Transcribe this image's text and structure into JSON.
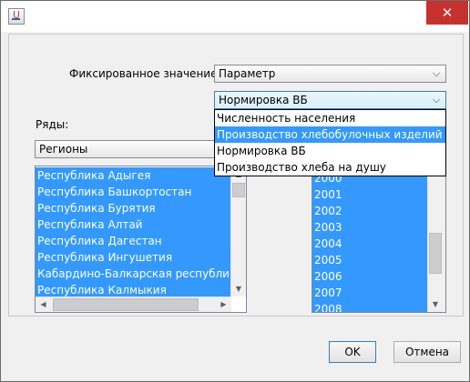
{
  "window": {
    "close_glyph": "✕"
  },
  "form": {
    "fixed_value_label": "Фиксированное значение:",
    "fixed_value_combo": "Параметр",
    "param_combo": "Нормировка ВБ",
    "rows_label": "Ряды:",
    "rows_combo": "Регионы"
  },
  "dropdown": {
    "options": [
      {
        "label": "Численность населения",
        "selected": false
      },
      {
        "label": "Производство хлебобулочных изделий",
        "selected": true
      },
      {
        "label": "Нормировка ВБ",
        "selected": false
      },
      {
        "label": "Производство хлеба на душу",
        "selected": false
      }
    ]
  },
  "regions": [
    "Республика Адыгея",
    "Республика Башкортостан",
    "Республика Бурятия",
    "Республика Алтай",
    "Республика Дагестан",
    "Республика Ингушетия",
    "Кабардино-Балкарская республика",
    "Республика Калмыкия"
  ],
  "years": [
    "2000",
    "2001",
    "2002",
    "2003",
    "2004",
    "2005",
    "2006",
    "2007",
    "2008"
  ],
  "buttons": {
    "ok": "OK",
    "cancel": "Отмена"
  }
}
